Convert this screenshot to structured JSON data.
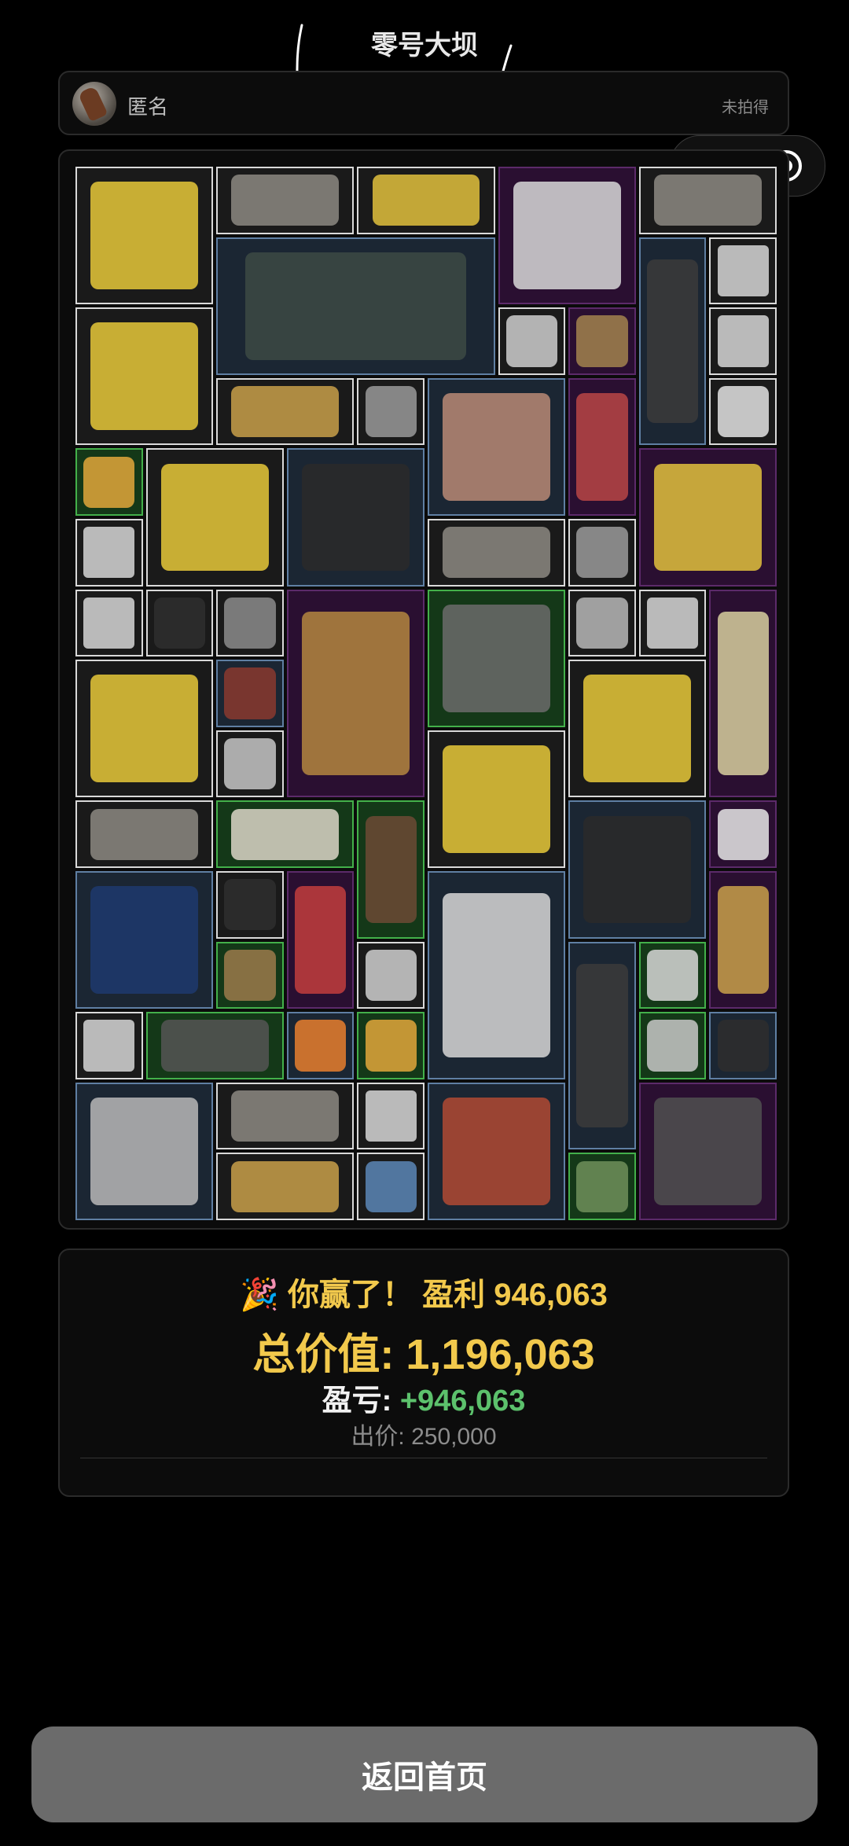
{
  "header": {
    "title": "零号大坝"
  },
  "user": {
    "name": "匿名",
    "status": "未拍得"
  },
  "grid": {
    "items": [
      {
        "kind": "candle",
        "tier": "white"
      },
      {
        "kind": "photo",
        "tier": "white"
      },
      {
        "kind": "knife",
        "tier": "white"
      },
      {
        "kind": "centrifuge",
        "tier": "purple"
      },
      {
        "kind": "photo",
        "tier": "white"
      },
      {
        "kind": "solar-panel",
        "tier": "blue"
      },
      {
        "kind": "recorder",
        "tier": "blue"
      },
      {
        "kind": "card",
        "tier": "white"
      },
      {
        "kind": "candle",
        "tier": "white"
      },
      {
        "kind": "yogurt",
        "tier": "white"
      },
      {
        "kind": "spear",
        "tier": "purple"
      },
      {
        "kind": "card",
        "tier": "white"
      },
      {
        "kind": "hammer",
        "tier": "white"
      },
      {
        "kind": "tape",
        "tier": "white"
      },
      {
        "kind": "magazine",
        "tier": "blue"
      },
      {
        "kind": "wrench",
        "tier": "purple"
      },
      {
        "kind": "cloth",
        "tier": "white"
      },
      {
        "kind": "screwdriver",
        "tier": "green"
      },
      {
        "kind": "candle",
        "tier": "white"
      },
      {
        "kind": "screen",
        "tier": "blue"
      },
      {
        "kind": "saw",
        "tier": "purple"
      },
      {
        "kind": "card",
        "tier": "white"
      },
      {
        "kind": "photo",
        "tier": "white"
      },
      {
        "kind": "tape-measure",
        "tier": "white"
      },
      {
        "kind": "card",
        "tier": "white"
      },
      {
        "kind": "jar",
        "tier": "white"
      },
      {
        "kind": "mouse",
        "tier": "white"
      },
      {
        "kind": "lamp",
        "tier": "purple"
      },
      {
        "kind": "spice-rack",
        "tier": "green"
      },
      {
        "kind": "matches",
        "tier": "white"
      },
      {
        "kind": "card",
        "tier": "white"
      },
      {
        "kind": "lantern",
        "tier": "purple"
      },
      {
        "kind": "candle",
        "tier": "white"
      },
      {
        "kind": "bag",
        "tier": "blue"
      },
      {
        "kind": "candle",
        "tier": "white"
      },
      {
        "kind": "scissors",
        "tier": "white"
      },
      {
        "kind": "candle",
        "tier": "white"
      },
      {
        "kind": "photo",
        "tier": "white"
      },
      {
        "kind": "document",
        "tier": "green"
      },
      {
        "kind": "statue",
        "tier": "green"
      },
      {
        "kind": "screen",
        "tier": "blue"
      },
      {
        "kind": "vest",
        "tier": "purple"
      },
      {
        "kind": "paint-can",
        "tier": "blue"
      },
      {
        "kind": "jar",
        "tier": "white"
      },
      {
        "kind": "torch",
        "tier": "purple"
      },
      {
        "kind": "cement",
        "tier": "blue"
      },
      {
        "kind": "faucet",
        "tier": "purple"
      },
      {
        "kind": "rope",
        "tier": "green"
      },
      {
        "kind": "tag",
        "tier": "white"
      },
      {
        "kind": "recorder",
        "tier": "blue"
      },
      {
        "kind": "power-strip",
        "tier": "green"
      },
      {
        "kind": "card",
        "tier": "white"
      },
      {
        "kind": "keyboard",
        "tier": "green"
      },
      {
        "kind": "pills",
        "tier": "blue"
      },
      {
        "kind": "screwdriver",
        "tier": "green"
      },
      {
        "kind": "forceps",
        "tier": "green"
      },
      {
        "kind": "battery",
        "tier": "blue"
      },
      {
        "kind": "stove",
        "tier": "blue"
      },
      {
        "kind": "photo",
        "tier": "white"
      },
      {
        "kind": "card",
        "tier": "white"
      },
      {
        "kind": "gas-tank",
        "tier": "blue"
      },
      {
        "kind": "motherboard",
        "tier": "purple"
      },
      {
        "kind": "hammer",
        "tier": "white"
      },
      {
        "kind": "cable",
        "tier": "white"
      },
      {
        "kind": "money",
        "tier": "green"
      }
    ]
  },
  "result": {
    "win_text": "🎉 你赢了！ 盈利 946,063",
    "total_label": "总价值: ",
    "total_value": "1,196,063",
    "pnl_label": "盈亏: ",
    "pnl_value": "+946,063",
    "bid_label": "出价: ",
    "bid_value": "250,000"
  },
  "buttons": {
    "home": "返回首页"
  },
  "colors": {
    "tier_white": "#d9d9d9",
    "tier_blue": "#5f7fa3",
    "tier_purple": "#5c2a6a",
    "tier_green": "#43b04a",
    "gold": "#f2c94c",
    "profit_green": "#5cc16c"
  }
}
